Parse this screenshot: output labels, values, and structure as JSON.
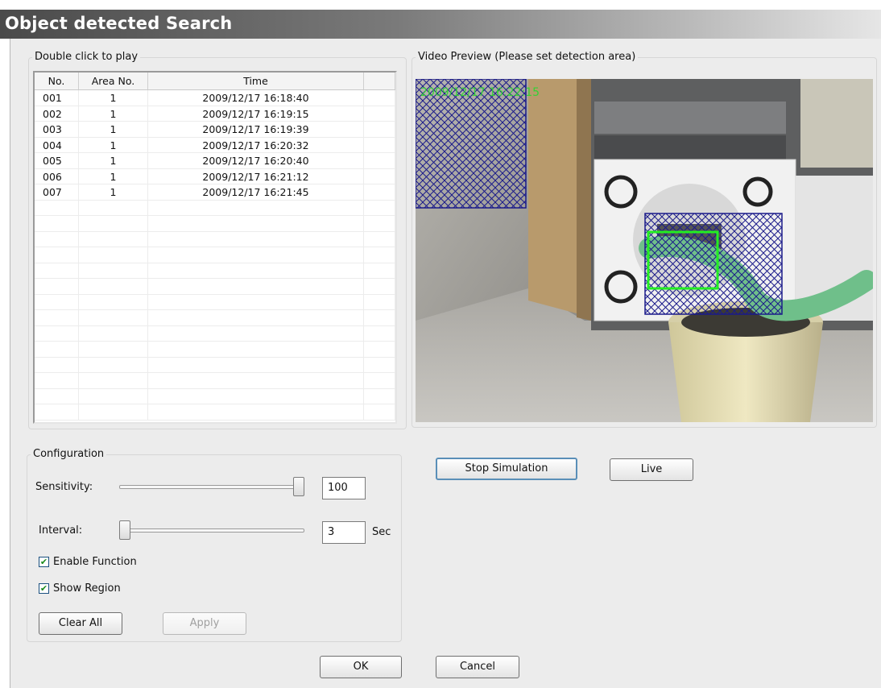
{
  "window": {
    "title": "Object detected Search"
  },
  "events": {
    "legend": "Double click to play",
    "columns": [
      "No.",
      "Area No.",
      "Time"
    ],
    "rows": [
      {
        "no": "001",
        "area": "1",
        "time": "2009/12/17 16:18:40"
      },
      {
        "no": "002",
        "area": "1",
        "time": "2009/12/17 16:19:15"
      },
      {
        "no": "003",
        "area": "1",
        "time": "2009/12/17 16:19:39"
      },
      {
        "no": "004",
        "area": "1",
        "time": "2009/12/17 16:20:32"
      },
      {
        "no": "005",
        "area": "1",
        "time": "2009/12/17 16:20:40"
      },
      {
        "no": "006",
        "area": "1",
        "time": "2009/12/17 16:21:12"
      },
      {
        "no": "007",
        "area": "1",
        "time": "2009/12/17 16:21:45"
      }
    ]
  },
  "preview": {
    "legend": "Video Preview (Please set detection area)",
    "timestamp": "2009/12/17 16:22:15"
  },
  "config": {
    "legend": "Configuration",
    "sensitivity": {
      "label": "Sensitivity:",
      "value": "100",
      "level": 1.0
    },
    "interval": {
      "label": "Interval:",
      "value": "3",
      "unit": "Sec",
      "level": 0.0
    },
    "enable_function": {
      "label": "Enable Function",
      "checked": true
    },
    "show_region": {
      "label": "Show Region",
      "checked": true
    },
    "clear_all": "Clear All",
    "apply": "Apply"
  },
  "actions": {
    "stop_simulation": "Stop Simulation",
    "live": "Live",
    "ok": "OK",
    "cancel": "Cancel"
  }
}
